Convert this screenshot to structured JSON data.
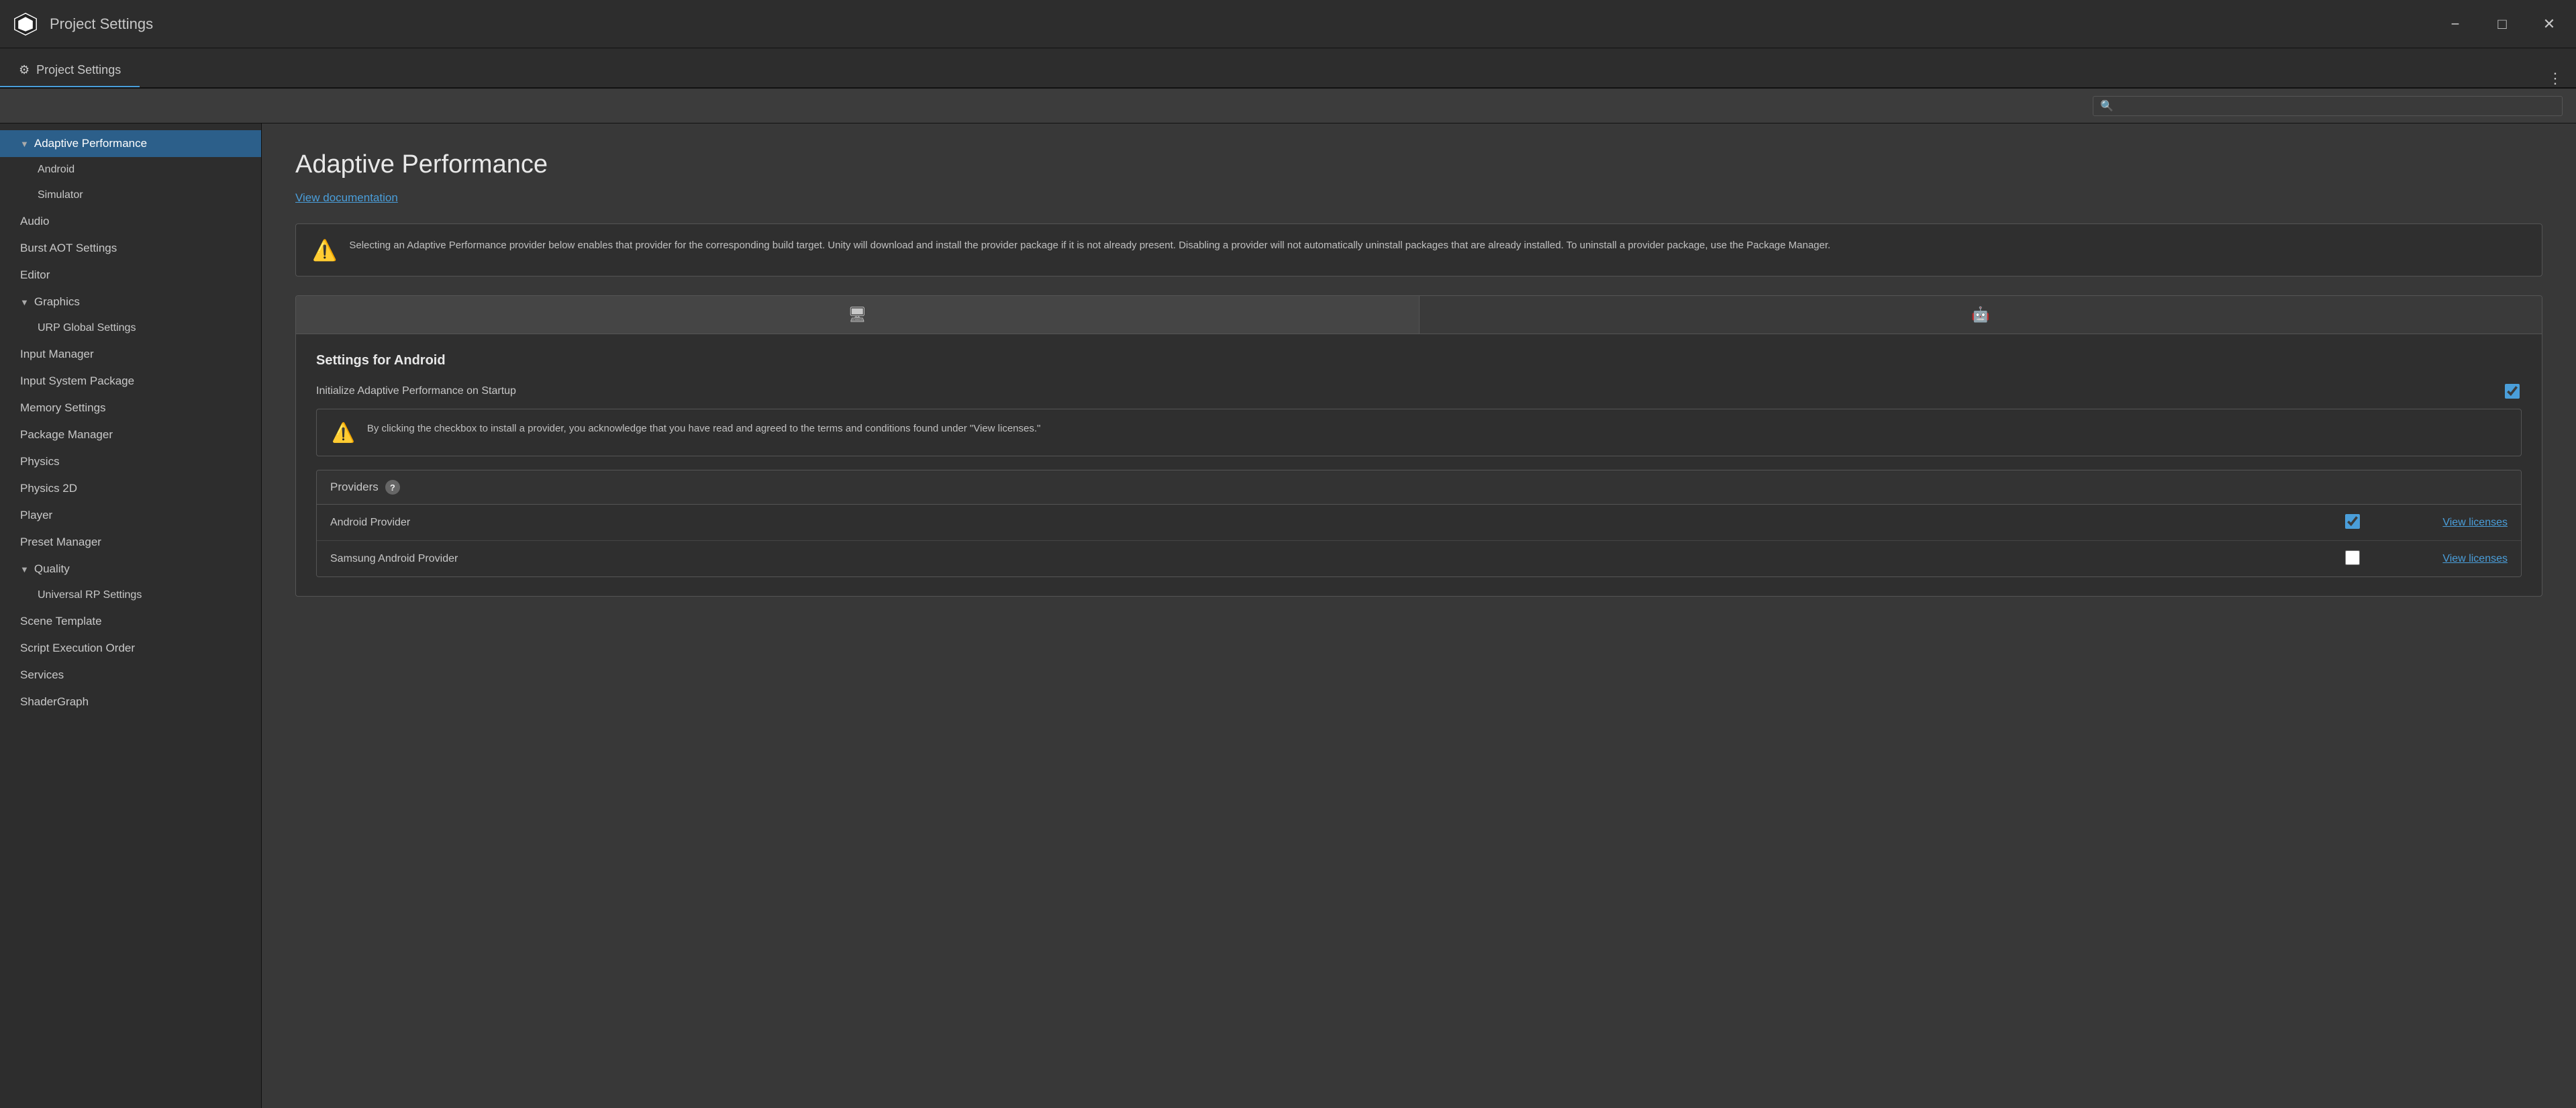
{
  "titleBar": {
    "title": "Project Settings",
    "controls": {
      "minimize": "−",
      "maximize": "□",
      "close": "✕"
    }
  },
  "tab": {
    "label": "Project Settings",
    "menuBtn": "⋮"
  },
  "search": {
    "placeholder": ""
  },
  "sidebar": {
    "items": [
      {
        "id": "adaptive-performance",
        "label": "Adaptive Performance",
        "level": 0,
        "arrow": "▼",
        "active": true
      },
      {
        "id": "android",
        "label": "Android",
        "level": 1,
        "active": false
      },
      {
        "id": "simulator",
        "label": "Simulator",
        "level": 1,
        "active": false
      },
      {
        "id": "audio",
        "label": "Audio",
        "level": 0,
        "active": false
      },
      {
        "id": "burst-aot",
        "label": "Burst AOT Settings",
        "level": 0,
        "active": false
      },
      {
        "id": "editor",
        "label": "Editor",
        "level": 0,
        "active": false
      },
      {
        "id": "graphics",
        "label": "Graphics",
        "level": 0,
        "arrow": "▼",
        "active": false
      },
      {
        "id": "urp-global",
        "label": "URP Global Settings",
        "level": 1,
        "active": false
      },
      {
        "id": "input-manager",
        "label": "Input Manager",
        "level": 0,
        "active": false
      },
      {
        "id": "input-system",
        "label": "Input System Package",
        "level": 0,
        "active": false
      },
      {
        "id": "memory-settings",
        "label": "Memory Settings",
        "level": 0,
        "active": false
      },
      {
        "id": "package-manager",
        "label": "Package Manager",
        "level": 0,
        "active": false
      },
      {
        "id": "physics",
        "label": "Physics",
        "level": 0,
        "active": false
      },
      {
        "id": "physics-2d",
        "label": "Physics 2D",
        "level": 0,
        "active": false
      },
      {
        "id": "player",
        "label": "Player",
        "level": 0,
        "active": false
      },
      {
        "id": "preset-manager",
        "label": "Preset Manager",
        "level": 0,
        "active": false
      },
      {
        "id": "quality",
        "label": "Quality",
        "level": 0,
        "arrow": "▼",
        "active": false
      },
      {
        "id": "universal-rp",
        "label": "Universal RP Settings",
        "level": 1,
        "active": false
      },
      {
        "id": "scene-template",
        "label": "Scene Template",
        "level": 0,
        "active": false
      },
      {
        "id": "script-execution",
        "label": "Script Execution Order",
        "level": 0,
        "active": false
      },
      {
        "id": "services",
        "label": "Services",
        "level": 0,
        "active": false
      },
      {
        "id": "shadergraph",
        "label": "ShaderGraph",
        "level": 0,
        "active": false
      }
    ]
  },
  "content": {
    "title": "Adaptive Performance",
    "viewDocLabel": "View documentation",
    "infoBox": {
      "text": "Selecting an Adaptive Performance provider below enables that provider for the corresponding build target. Unity will download and install the provider package if it is not already present. Disabling a provider will not automatically uninstall packages that are already installed. To uninstall a provider package, use the Package Manager."
    },
    "platformTabs": [
      {
        "id": "desktop",
        "icon": "🖥",
        "active": true
      },
      {
        "id": "android",
        "icon": "🤖",
        "active": false
      }
    ],
    "androidSettings": {
      "sectionTitle": "Settings for Android",
      "initLabel": "Initialize Adaptive Performance on Startup",
      "initChecked": true
    },
    "warningBox": {
      "text": "By clicking the checkbox to install a provider, you acknowledge that you have read and agreed to the terms and conditions found under \"View licenses.\""
    },
    "providers": {
      "label": "Providers",
      "items": [
        {
          "id": "android-provider",
          "name": "Android Provider",
          "checked": true,
          "licensesLabel": "View licenses"
        },
        {
          "id": "samsung-provider",
          "name": "Samsung Android Provider",
          "checked": false,
          "licensesLabel": "View licenses"
        }
      ]
    }
  }
}
